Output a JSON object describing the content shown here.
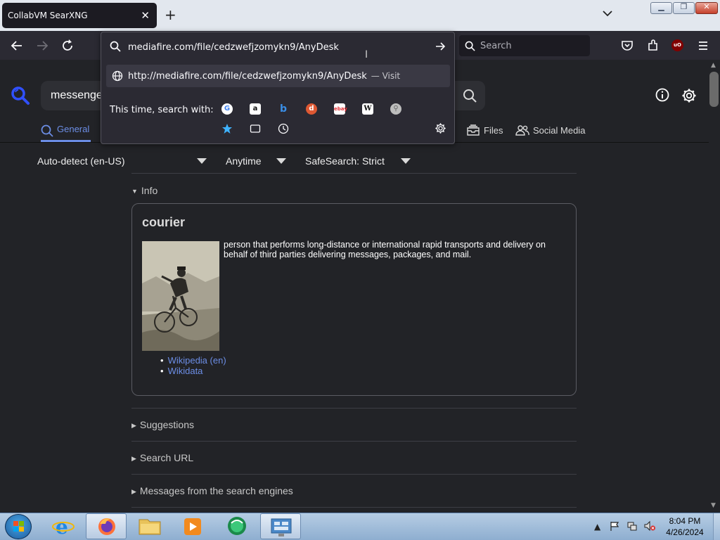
{
  "browser": {
    "tab_title": "CollabVM SearXNG",
    "tab_close": "✕",
    "new_tab": "+",
    "search_placeholder": "Search"
  },
  "url_popup": {
    "url_value": "mediafire.com/file/cedzwefjzomykn9/AnyDesk",
    "suggestion_url": "http://mediafire.com/file/cedzwefjzomykn9/AnyDesk",
    "suggestion_action": "— Visit",
    "search_with_label": "This time, search with:",
    "engines": [
      "google-icon",
      "amazon-icon",
      "bing-icon",
      "duckduckgo-icon",
      "ebay-icon",
      "wikipedia-icon",
      "search-engine-icon",
      "bookmarks-icon",
      "tabs-icon",
      "history-icon"
    ]
  },
  "page": {
    "query_value": "messenge",
    "categories": {
      "general": "General",
      "files": "Files",
      "social": "Social Media"
    },
    "filters": {
      "language": "Auto-detect (en-US)",
      "time": "Anytime",
      "safesearch": "SafeSearch: Strict"
    },
    "sections": {
      "info": "Info",
      "suggestions": "Suggestions",
      "search_url": "Search URL",
      "messages": "Messages from the search engines"
    },
    "infobox": {
      "title": "courier",
      "description": "person that performs long-distance or international rapid transports and delivery on behalf of third parties delivering messages, packages, and mail.",
      "links": [
        "Wikipedia (en)",
        "Wikidata"
      ]
    }
  },
  "taskbar": {
    "time": "8:04 PM",
    "date": "4/26/2024"
  },
  "colors": {
    "accent": "#6c8ee6",
    "background": "#222327",
    "toolbar": "#2b2a33"
  }
}
